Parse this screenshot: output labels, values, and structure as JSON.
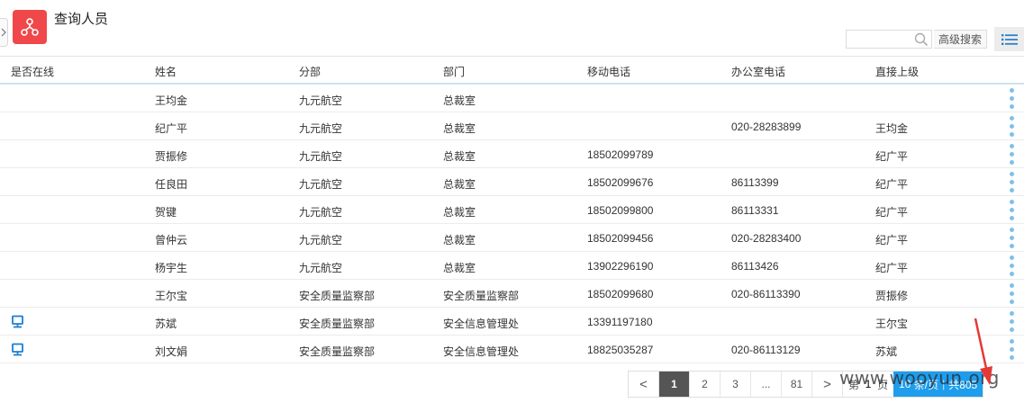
{
  "page": {
    "title": "查询人员"
  },
  "search": {
    "placeholder": "",
    "advanced_label": "高级搜索"
  },
  "table": {
    "columns": [
      "是否在线",
      "姓名",
      "分部",
      "部门",
      "移动电话",
      "办公室电话",
      "直接上级"
    ],
    "rows": [
      {
        "online": false,
        "name": "王均金",
        "branch": "九元航空",
        "dept": "总裁室",
        "mobile": "",
        "office": "",
        "manager": ""
      },
      {
        "online": false,
        "name": "纪广平",
        "branch": "九元航空",
        "dept": "总裁室",
        "mobile": "",
        "office": "020-28283899",
        "manager": "王均金"
      },
      {
        "online": false,
        "name": "贾振修",
        "branch": "九元航空",
        "dept": "总裁室",
        "mobile": "18502099789",
        "office": "",
        "manager": "纪广平"
      },
      {
        "online": false,
        "name": "任良田",
        "branch": "九元航空",
        "dept": "总裁室",
        "mobile": "18502099676",
        "office": "86113399",
        "manager": "纪广平"
      },
      {
        "online": false,
        "name": "贺键",
        "branch": "九元航空",
        "dept": "总裁室",
        "mobile": "18502099800",
        "office": "86113331",
        "manager": "纪广平"
      },
      {
        "online": false,
        "name": "曾仲云",
        "branch": "九元航空",
        "dept": "总裁室",
        "mobile": "18502099456",
        "office": "020-28283400",
        "manager": "纪广平"
      },
      {
        "online": false,
        "name": "杨宇生",
        "branch": "九元航空",
        "dept": "总裁室",
        "mobile": "13902296190",
        "office": "86113426",
        "manager": "纪广平"
      },
      {
        "online": false,
        "name": "王尔宝",
        "branch": "安全质量监察部",
        "dept": "安全质量监察部",
        "mobile": "18502099680",
        "office": "020-86113390",
        "manager": "贾振修"
      },
      {
        "online": true,
        "name": "苏斌",
        "branch": "安全质量监察部",
        "dept": "安全信息管理处",
        "mobile": "13391197180",
        "office": "",
        "manager": "王尔宝"
      },
      {
        "online": true,
        "name": "刘文娟",
        "branch": "安全质量监察部",
        "dept": "安全信息管理处",
        "mobile": "18825035287",
        "office": "020-86113129",
        "manager": "苏斌"
      }
    ]
  },
  "pagination": {
    "prev": "<",
    "pages": [
      "1",
      "2",
      "3",
      "...",
      "81"
    ],
    "current": "1",
    "next": ">",
    "goto_prefix": "第",
    "goto_value": "1",
    "goto_suffix": "页",
    "page_size": "10",
    "per_page_label": "条/页",
    "total_label": "共805"
  },
  "watermark": "www.wooyun.org",
  "colors": {
    "accent": "#1e9ded",
    "icon_red": "#f0484a",
    "online_icon": "#1a7fd4",
    "row_menu": "#7ec1ea"
  },
  "icons": {
    "app": "org-chart-icon",
    "search": "search-icon",
    "view": "list-view-icon",
    "online": "computer-icon",
    "menu": "more-vertical-icon"
  }
}
